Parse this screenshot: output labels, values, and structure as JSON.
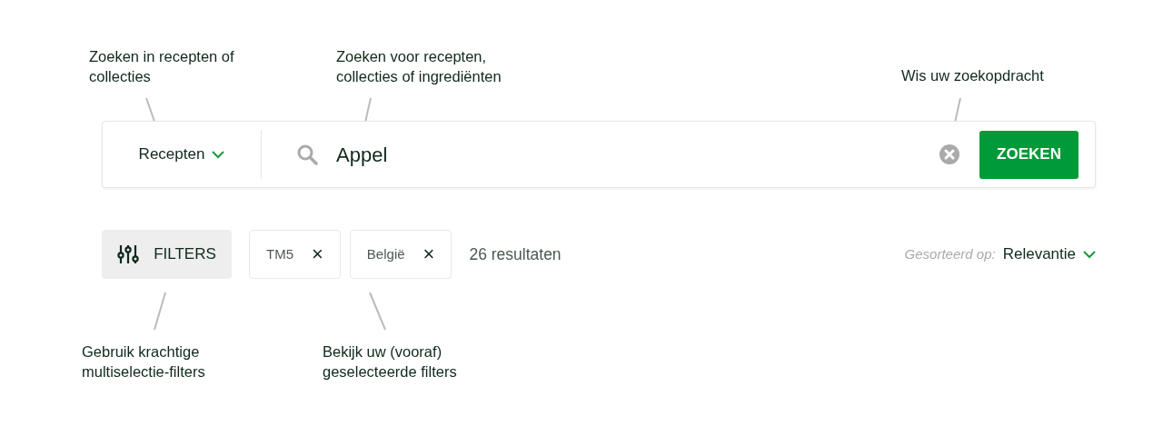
{
  "annotations_top": [
    {
      "text": "Zoeken in recepten of collecties"
    },
    {
      "text": "Zoeken voor recepten, collecties of ingrediënten"
    },
    {
      "text": "Wis uw zoekopdracht"
    }
  ],
  "search_bar": {
    "scope": "Recepten",
    "query": "Appel",
    "button": "ZOEKEN"
  },
  "filter_bar": {
    "filters_button": "FILTERS",
    "chips": [
      {
        "label": "TM5",
        "remove": "×"
      },
      {
        "label": "België",
        "remove": "×"
      }
    ],
    "results": "26 resultaten",
    "sort_label": "Gesorteerd op:",
    "sort_value": "Relevantie"
  },
  "annotations_bottom": [
    {
      "text": "Gebruik krachtige multiselectie-filters"
    },
    {
      "text": "Bekijk uw (vooraf) geselecteerde filters"
    }
  ]
}
